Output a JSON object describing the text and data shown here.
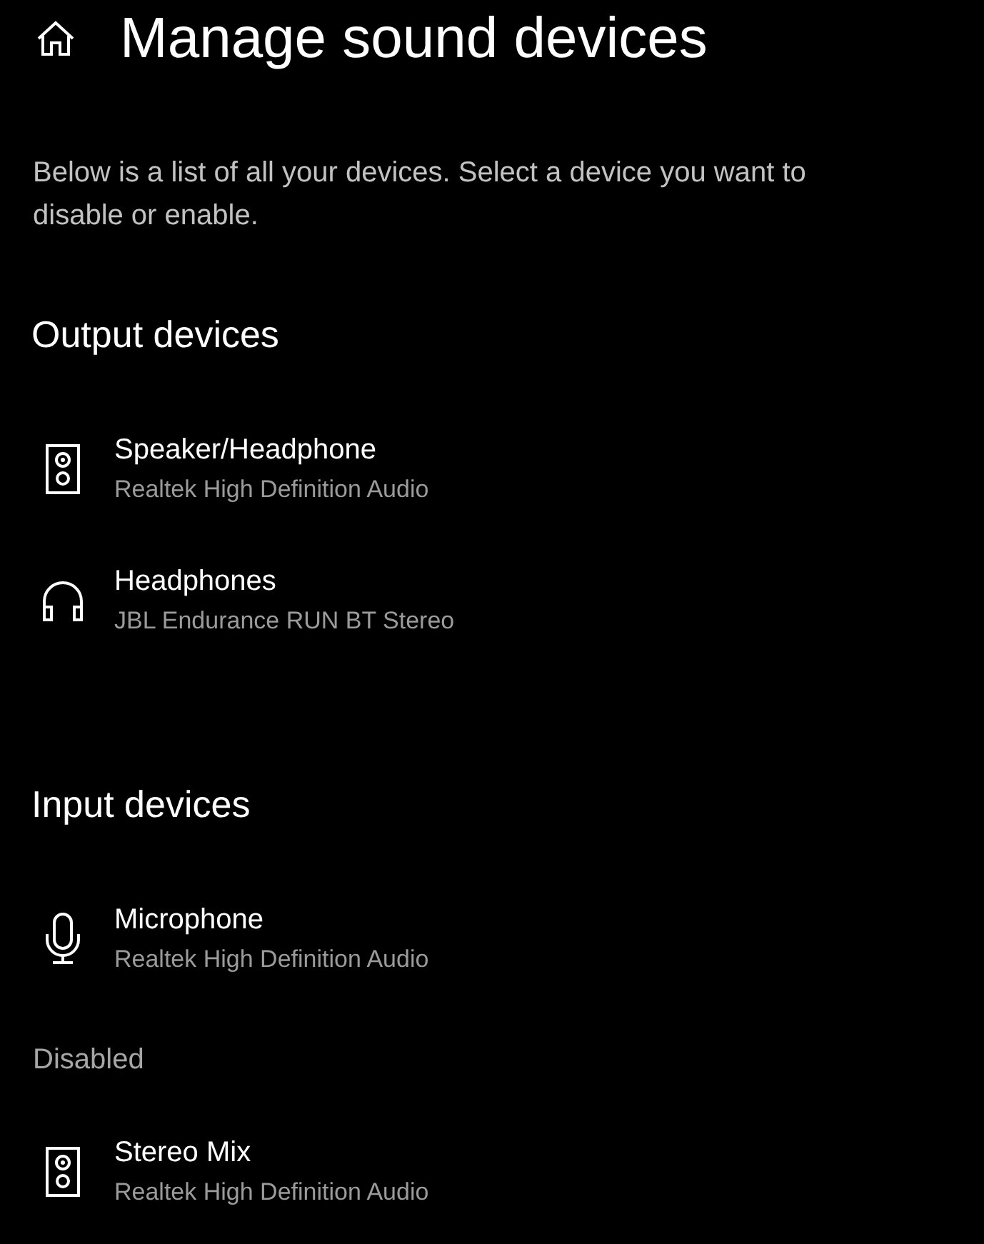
{
  "header": {
    "title": "Manage sound devices"
  },
  "description": "Below is a list of all your devices. Select a device you want to disable or enable.",
  "sections": [
    {
      "heading": "Output devices",
      "devices": [
        {
          "kind": "speaker",
          "name": "Speaker/Headphone",
          "driver": "Realtek High Definition Audio"
        },
        {
          "kind": "headphones",
          "name": "Headphones",
          "driver": "JBL Endurance RUN BT Stereo"
        }
      ]
    },
    {
      "heading": "Input devices",
      "devices": [
        {
          "kind": "microphone",
          "name": "Microphone",
          "driver": "Realtek High Definition Audio"
        }
      ],
      "disabled": {
        "heading": "Disabled",
        "devices": [
          {
            "kind": "speaker",
            "name": "Stereo Mix",
            "driver": "Realtek High Definition Audio"
          }
        ]
      }
    }
  ]
}
